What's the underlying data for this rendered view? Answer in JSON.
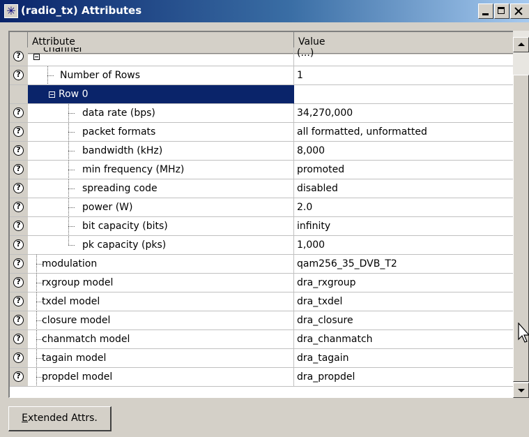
{
  "window": {
    "title": "(radio_tx) Attributes",
    "icon": "asterisk-icon"
  },
  "table": {
    "headers": {
      "attribute": "Attribute",
      "value": "Value"
    },
    "rows": [
      {
        "label": "channel",
        "value": "(...)",
        "depth": 0,
        "expander": true,
        "help": true,
        "partial": true
      },
      {
        "label": "Number of Rows",
        "value": "1",
        "depth": 1,
        "help": true
      },
      {
        "label": "Row 0",
        "value": "",
        "depth": 1,
        "expander": true,
        "help": false,
        "selected": true
      },
      {
        "label": "data rate (bps)",
        "value": "34,270,000",
        "depth": 2,
        "help": true
      },
      {
        "label": "packet formats",
        "value": "all formatted, unformatted",
        "depth": 2,
        "help": true
      },
      {
        "label": "bandwidth (kHz)",
        "value": "8,000",
        "depth": 2,
        "help": true
      },
      {
        "label": "min frequency (MHz)",
        "value": "promoted",
        "depth": 2,
        "help": true
      },
      {
        "label": "spreading code",
        "value": "disabled",
        "depth": 2,
        "help": true
      },
      {
        "label": "power (W)",
        "value": "2.0",
        "depth": 2,
        "help": true
      },
      {
        "label": "bit capacity (bits)",
        "value": "infinity",
        "depth": 2,
        "help": true
      },
      {
        "label": "pk capacity (pks)",
        "value": "1,000",
        "depth": 2,
        "help": true,
        "last": true
      },
      {
        "label": "modulation",
        "value": "qam256_35_DVB_T2",
        "depth": 0,
        "help": true
      },
      {
        "label": "rxgroup model",
        "value": "dra_rxgroup",
        "depth": 0,
        "help": true
      },
      {
        "label": "txdel model",
        "value": "dra_txdel",
        "depth": 0,
        "help": true
      },
      {
        "label": "closure model",
        "value": "dra_closure",
        "depth": 0,
        "help": true
      },
      {
        "label": "chanmatch model",
        "value": "dra_chanmatch",
        "depth": 0,
        "help": true
      },
      {
        "label": "tagain model",
        "value": "dra_tagain",
        "depth": 0,
        "help": true
      },
      {
        "label": "propdel model",
        "value": "dra_propdel",
        "depth": 0,
        "help": true
      }
    ]
  },
  "footer": {
    "extended_accel": "E",
    "extended_rest": "xtended Attrs."
  }
}
